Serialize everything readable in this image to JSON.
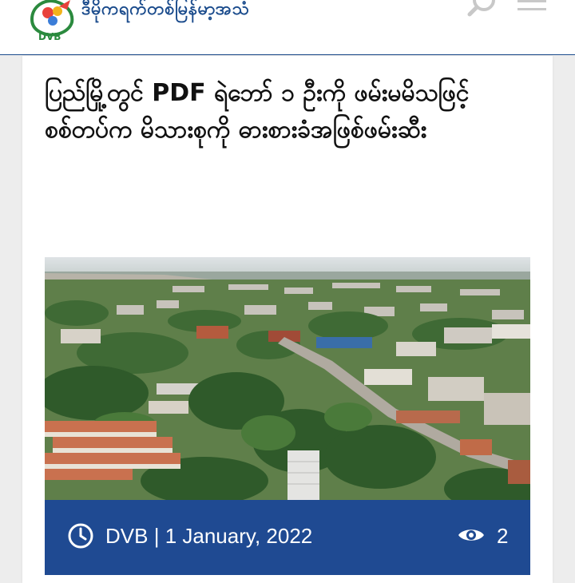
{
  "header": {
    "site_name": "ဒီမိုကရက်တစ်မြန်မာ့အသံ",
    "logo_text": "DVB",
    "search_icon": "search-icon",
    "menu_icon": "hamburger-menu-icon",
    "colors": {
      "brand": "#1a4b8c",
      "logo_text": "#2b8a3e"
    }
  },
  "article": {
    "headline": "ပြည်မြို့တွင် PDF ရဲဘော် ၁ ဦးကို ဖမ်းမမိသဖြင့် စစ်တပ်က မိသားစုကို ဓားစားခံအဖြစ်ဖမ်းဆီး",
    "image_alt": "aerial view of town",
    "meta": {
      "author": "DVB",
      "separator": "|",
      "date": "1 January, 2022",
      "views": "2",
      "clock_icon": "clock-icon",
      "eye_icon": "eye-icon",
      "bar_color": "#1f4a92"
    }
  }
}
